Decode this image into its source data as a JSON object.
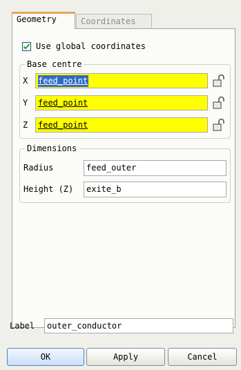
{
  "tabs": [
    {
      "label": "Geometry",
      "active": true
    },
    {
      "label": "Coordinates",
      "active": false
    }
  ],
  "use_global": {
    "label": "Use global coordinates",
    "checked": true
  },
  "base_centre": {
    "title": "Base centre",
    "rows": [
      {
        "axis": "X",
        "value": "feed_point",
        "selected": true
      },
      {
        "axis": "Y",
        "value": "feed_point",
        "selected": false
      },
      {
        "axis": "Z",
        "value": "feed_point",
        "selected": false
      }
    ],
    "lock_icon": "padlock-icon",
    "field_color": "#ffff00"
  },
  "dimensions": {
    "title": "Dimensions",
    "radius_label": "Radius",
    "radius_value": "feed_outer",
    "height_label": "Height (Z)",
    "height_value": "exite_b"
  },
  "label": {
    "label": "Label",
    "value": "outer_conductor"
  },
  "buttons": {
    "ok": "OK",
    "apply": "Apply",
    "cancel": "Cancel"
  }
}
